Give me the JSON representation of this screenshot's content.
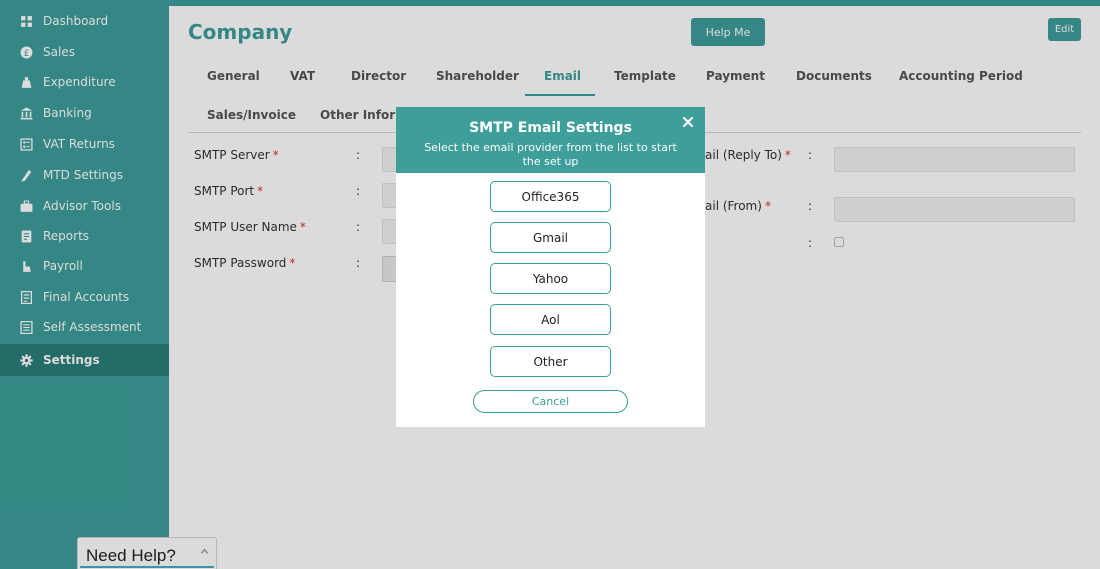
{
  "sidebar": {
    "items": [
      {
        "label": "Dashboard",
        "icon": "dashboard-icon"
      },
      {
        "label": "Sales",
        "icon": "sales-icon"
      },
      {
        "label": "Expenditure",
        "icon": "expenditure-icon"
      },
      {
        "label": "Banking",
        "icon": "bank-icon"
      },
      {
        "label": "VAT Returns",
        "icon": "vat-returns-icon"
      },
      {
        "label": "MTD Settings",
        "icon": "mtd-settings-icon"
      },
      {
        "label": "Advisor Tools",
        "icon": "briefcase-icon"
      },
      {
        "label": "Reports",
        "icon": "reports-icon"
      },
      {
        "label": "Payroll",
        "icon": "payroll-icon"
      },
      {
        "label": "Final Accounts",
        "icon": "final-accounts-icon"
      },
      {
        "label": "Self Assessment",
        "icon": "self-assessment-icon"
      },
      {
        "label": "Settings",
        "icon": "gear-icon"
      }
    ],
    "active": "Settings"
  },
  "help_widget": {
    "label": "Need Help?"
  },
  "header": {
    "title": "Company",
    "help_button": "Help Me",
    "edit_button": "Edit"
  },
  "tabs": [
    {
      "label": "General"
    },
    {
      "label": "VAT"
    },
    {
      "label": "Director"
    },
    {
      "label": "Shareholder"
    },
    {
      "label": "Email"
    },
    {
      "label": "Template"
    },
    {
      "label": "Payment"
    },
    {
      "label": "Documents"
    },
    {
      "label": "Accounting Period"
    },
    {
      "label": "Sales/Invoice"
    },
    {
      "label": "Other Inform"
    }
  ],
  "active_tab": "Email",
  "form": {
    "left": [
      {
        "label": "SMTP Server"
      },
      {
        "label": "SMTP Port"
      },
      {
        "label": "SMTP User Name"
      },
      {
        "label": "SMTP Password"
      }
    ],
    "right": [
      {
        "label": "ail (Reply To)"
      },
      {
        "label": "ail (From)"
      }
    ],
    "colon": ":",
    "required_mark": "*"
  },
  "modal": {
    "title": "SMTP Email Settings",
    "subtitle": "Select the email provider from the list to start the set up",
    "providers": [
      "Office365",
      "Gmail",
      "Yahoo",
      "Aol",
      "Other"
    ],
    "cancel": "Cancel"
  },
  "colors": {
    "brand": "#3d9e9a",
    "brand_dark": "#2a7e7a",
    "required": "#d9322c"
  }
}
